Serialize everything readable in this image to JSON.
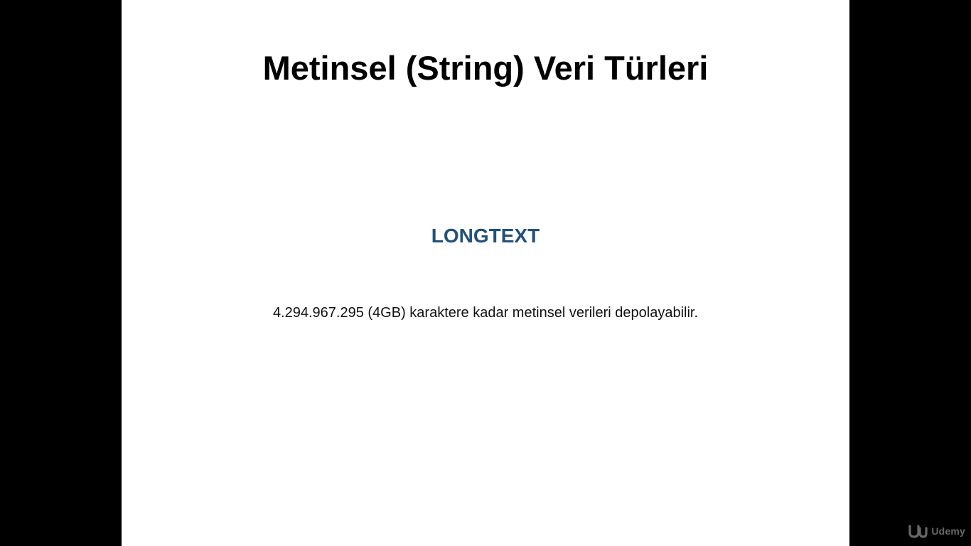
{
  "slide": {
    "title": "Metinsel (String) Veri Türleri",
    "subtitle": "LONGTEXT",
    "body": "4.294.967.295 (4GB) karaktere kadar metinsel verileri depolayabilir."
  },
  "watermark": {
    "icon": "udemy-logo-icon",
    "label": "Udemy"
  },
  "colors": {
    "background": "#000000",
    "slide": "#ffffff",
    "title": "#000000",
    "accent": "#23507c",
    "body": "#111111",
    "watermark": "#bdbdbd"
  }
}
